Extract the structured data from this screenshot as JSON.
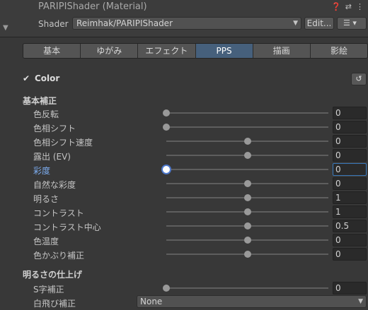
{
  "header": {
    "title": "PARIPIShader (Material)",
    "shader_label": "Shader",
    "shader_value": "Reimhak/PARIPIShader",
    "edit_label": "Edit...",
    "list_label": "☰ ▾"
  },
  "tabs": [
    {
      "label": "基本"
    },
    {
      "label": "ゆがみ"
    },
    {
      "label": "エフェクト"
    },
    {
      "label": "PPS",
      "active": true
    },
    {
      "label": "描画"
    },
    {
      "label": "影絵"
    }
  ],
  "color": {
    "label": "Color",
    "checked": true
  },
  "sections": {
    "basic": "基本補正",
    "brightness": "明るさの仕上げ"
  },
  "props": [
    {
      "label": "色反転",
      "value": "0",
      "pos": 0.0
    },
    {
      "label": "色相シフト",
      "value": "0",
      "pos": 0.0
    },
    {
      "label": "色相シフト速度",
      "value": "0",
      "pos": 0.5
    },
    {
      "label": "露出 (EV)",
      "value": "0",
      "pos": 0.5
    },
    {
      "label": "彩度",
      "value": "0",
      "pos": 0.0,
      "active": true
    },
    {
      "label": "自然な彩度",
      "value": "0",
      "pos": 0.5
    },
    {
      "label": "明るさ",
      "value": "1",
      "pos": 0.5
    },
    {
      "label": "コントラスト",
      "value": "1",
      "pos": 0.5
    },
    {
      "label": "コントラスト中心",
      "value": "0.5",
      "pos": 0.5
    },
    {
      "label": "色温度",
      "value": "0",
      "pos": 0.5
    },
    {
      "label": "色かぶり補正",
      "value": "0",
      "pos": 0.5
    }
  ],
  "props2": [
    {
      "label": "S字補正",
      "value": "0",
      "pos": 0.0
    }
  ],
  "whiteclip": {
    "label": "白飛び補正",
    "value": "None"
  },
  "colors": {
    "accent": "#46607c",
    "highlight": "#7cacef"
  }
}
